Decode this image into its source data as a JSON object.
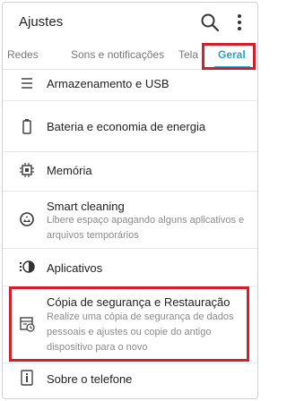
{
  "header": {
    "title": "Ajustes"
  },
  "tabs": [
    {
      "label": "Redes"
    },
    {
      "label": "Sons e notificações"
    },
    {
      "label": "Tela"
    },
    {
      "label": "Geral"
    }
  ],
  "items": [
    {
      "title": "Armazenamento e USB",
      "icon": "storage-icon"
    },
    {
      "title": "Bateria e economia de energia",
      "icon": "battery-icon"
    },
    {
      "title": "Memória",
      "icon": "memory-chip-icon"
    },
    {
      "title": "Smart cleaning",
      "subtitle": "Libere espaço apagando alguns aplicativos e arquivos temporários",
      "icon": "smart-cleaning-icon"
    },
    {
      "title": "Aplicativos",
      "icon": "apps-icon"
    },
    {
      "title": "Cópia de segurança e Restauração",
      "subtitle": "Realize uma cópia de segurança de dados pessoais e ajustes ou copie do antigo dispositivo para o novo",
      "icon": "backup-restore-icon"
    },
    {
      "title": "Sobre o telefone",
      "icon": "info-icon"
    }
  ],
  "colors": {
    "accent": "#27a5c9",
    "highlight": "#d21f2b"
  }
}
